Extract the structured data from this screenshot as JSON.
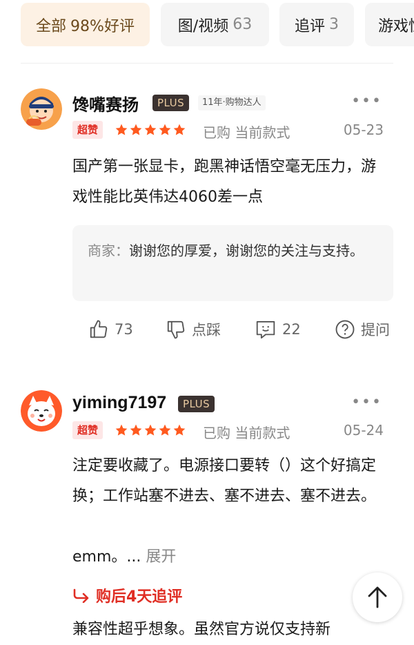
{
  "filter_tabs": [
    {
      "label": "全部",
      "count": "98%好评"
    },
    {
      "label": "图/视频",
      "count": "63"
    },
    {
      "label": "追评",
      "count": "3"
    },
    {
      "label": "游戏性",
      "count": ""
    }
  ],
  "reviews": [
    {
      "username": "馋嘴赛扬",
      "member_badge": "PLUS",
      "level_tag": "11年·购物达人",
      "tag": "超赞",
      "rating": 5,
      "purchase_info": "已购 当前款式",
      "date": "05-23",
      "content": "国产第一张显卡，跑黑神话悟空毫无压力，游戏性能比英伟达4060差一点",
      "merchant_reply_label": "商家：",
      "merchant_reply": "谢谢您的厚爱，谢谢您的关注与支持。",
      "likes": "73",
      "dislike_label": "点踩",
      "comments": "22",
      "ask_label": "提问"
    },
    {
      "username": "yiming7197",
      "member_badge": "PLUS",
      "tag": "超赞",
      "rating": 5,
      "purchase_info": "已购 当前款式",
      "date": "05-24",
      "content": "注定要收藏了。电源接口要转（）这个好搞定换；工作站塞不进去、塞不进去、塞不进去。",
      "content_tail": "emm。...",
      "expand_label": "展开",
      "followup_label": "购后4天追评",
      "followup_content": "兼容性超乎想象。虽然官方说仅支持新"
    }
  ],
  "colors": {
    "accent_red": "#e02e24",
    "star": "#ff5a1f",
    "plus_bg": "#3b3230"
  }
}
